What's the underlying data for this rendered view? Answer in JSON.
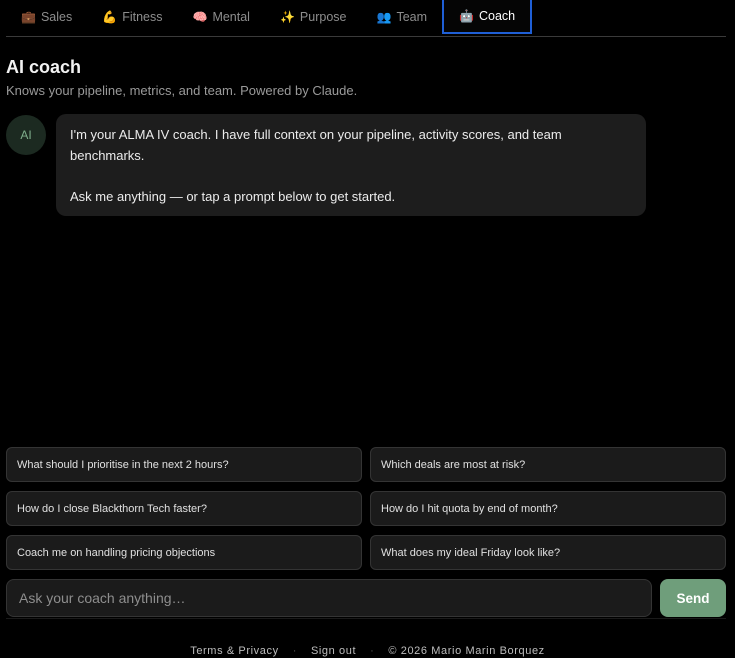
{
  "tabs": [
    {
      "icon": "💼",
      "icon_name": "briefcase-icon",
      "label": "Sales"
    },
    {
      "icon": "💪",
      "icon_name": "flexed-arm-icon",
      "label": "Fitness"
    },
    {
      "icon": "🧠",
      "icon_name": "brain-icon",
      "label": "Mental"
    },
    {
      "icon": "✨",
      "icon_name": "sparkles-icon",
      "label": "Purpose"
    },
    {
      "icon": "👥",
      "icon_name": "people-icon",
      "label": "Team"
    },
    {
      "icon": "🤖",
      "icon_name": "robot-icon",
      "label": "Coach"
    }
  ],
  "active_tab": "Coach",
  "header": {
    "title": "AI coach",
    "subtitle": "Knows your pipeline, metrics, and team. Powered by Claude."
  },
  "chat": {
    "avatar_label": "AI",
    "message": {
      "line1": "I'm your ALMA IV coach. I have full context on your pipeline, activity scores, and team benchmarks.",
      "line2": "Ask me anything — or tap a prompt below to get started."
    }
  },
  "prompts": [
    "What should I prioritise in the next 2 hours?",
    "Which deals are most at risk?",
    "How do I close Blackthorn Tech faster?",
    "How do I hit quota by end of month?",
    "Coach me on handling pricing objections",
    "What does my ideal Friday look like?"
  ],
  "composer": {
    "placeholder": "Ask your coach anything…",
    "value": "",
    "send_label": "Send"
  },
  "footer": {
    "terms": "Terms & Privacy",
    "separator": "·",
    "signout": "Sign out",
    "copyright": "© 2026 Mario Marin Borquez"
  },
  "colors": {
    "background": "#000000",
    "active_tab_border": "#1f5fd6",
    "send_button": "#6f9e7b",
    "bubble": "#1d1d1d"
  }
}
